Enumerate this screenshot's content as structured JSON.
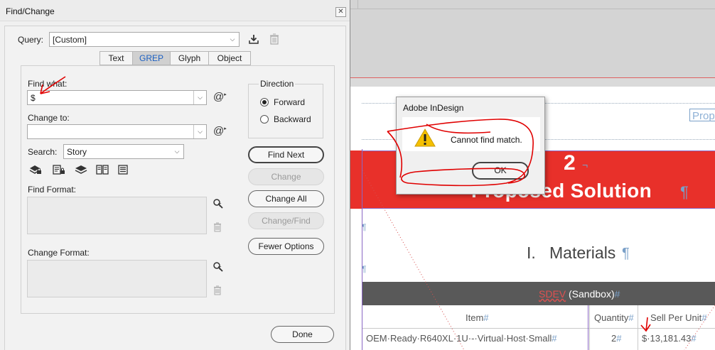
{
  "find_change": {
    "title": "Find/Change",
    "close_glyph": "✕",
    "query_label": "Query:",
    "query_value": "[Custom]",
    "tabs": [
      {
        "label": "Text"
      },
      {
        "label": "GREP"
      },
      {
        "label": "Glyph"
      },
      {
        "label": "Object"
      }
    ],
    "active_tab": "GREP",
    "find_what_label": "Find what:",
    "find_what_value": "$",
    "change_to_label": "Change to:",
    "change_to_value": "",
    "search_label": "Search:",
    "search_value": "Story",
    "direction_label": "Direction",
    "direction_forward": "Forward",
    "direction_backward": "Backward",
    "direction_selected": "Forward",
    "buttons": {
      "find_next": "Find Next",
      "change": "Change",
      "change_all": "Change All",
      "change_find": "Change/Find",
      "fewer_options": "Fewer Options",
      "done": "Done"
    },
    "find_format_label": "Find Format:",
    "change_format_label": "Change Format:",
    "icons": {
      "save_query": "save-query-icon",
      "delete_query": "delete-query-icon",
      "special_chars": "special-characters-icon",
      "include_locked_layers": "include-locked-layers-icon",
      "include_locked_stories": "include-locked-stories-icon",
      "include_hidden_layers": "include-hidden-layers-icon",
      "include_master_pages": "include-master-pages-icon",
      "include_footnotes": "include-footnotes-icon",
      "specify_attributes": "specify-attributes-icon",
      "clear_attributes": "clear-attributes-icon"
    }
  },
  "alert": {
    "title": "Adobe InDesign",
    "message": "Cannot find match.",
    "ok_label": "OK"
  },
  "document": {
    "header_text": "Prop",
    "chapter_number": "2",
    "chapter_title": "Proposed Solution",
    "section_numeral": "I.",
    "section_title": "Materials",
    "table_title_word": "SDEV",
    "table_title_rest": "(Sandbox)",
    "columns": [
      "Item",
      "Quantity",
      "Sell Per Unit"
    ],
    "rows": [
      {
        "item": "OEM·Ready·R640XL·1U·-·Virtual·Host·Small",
        "quantity": "2",
        "sell_per_unit": "$·13,181.43"
      }
    ],
    "pilcrow": "¶",
    "cell_end": "#"
  },
  "colors": {
    "banner_red": "#e8302a",
    "table_header_gray": "#595959",
    "annotation_red": "#e00000",
    "guide_purple": "#8a66c4",
    "warning_yellow": "#f5c000",
    "grep_tab_blue": "#1b5fc2"
  }
}
